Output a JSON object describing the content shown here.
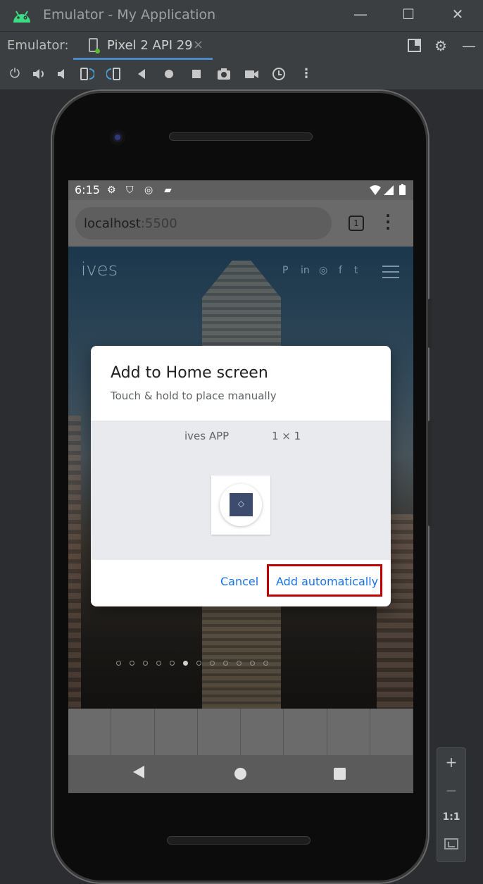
{
  "window": {
    "title": "Emulator - My Application",
    "app_icon": "android-icon",
    "controls": {
      "minimize": "—",
      "maximize": "☐",
      "close": "✕"
    }
  },
  "tabbar": {
    "label": "Emulator:",
    "tab_name": "Pixel 2 API 29",
    "tab_close": "×"
  },
  "toolbar": {
    "icons": [
      "power-icon",
      "volume-up-icon",
      "volume-down-icon",
      "rotate-left-icon",
      "rotate-right-icon",
      "back-icon",
      "home-icon",
      "overview-icon",
      "screenshot-icon",
      "screenrecord-icon",
      "snapshot-icon",
      "more-icon"
    ]
  },
  "device": {
    "status": {
      "time": "6:15"
    },
    "url": {
      "host": "localhost",
      "port": ":5500"
    },
    "tabs_count": "1",
    "web": {
      "brand": "ives",
      "social": [
        "P",
        "in",
        "◎",
        "f",
        "t"
      ]
    }
  },
  "dialog": {
    "title": "Add to Home screen",
    "subtitle": "Touch & hold to place manually",
    "app_name": "ives APP",
    "app_size": "1 × 1",
    "cancel_label": "Cancel",
    "add_label": "Add automatically"
  },
  "zoom_panel": {
    "zoom_in": "+",
    "zoom_out": "−",
    "one_to_one": "1:1"
  },
  "colors": {
    "accent": "#1a73e8",
    "highlight": "#c00000",
    "tab_underline": "#4a88c7"
  }
}
